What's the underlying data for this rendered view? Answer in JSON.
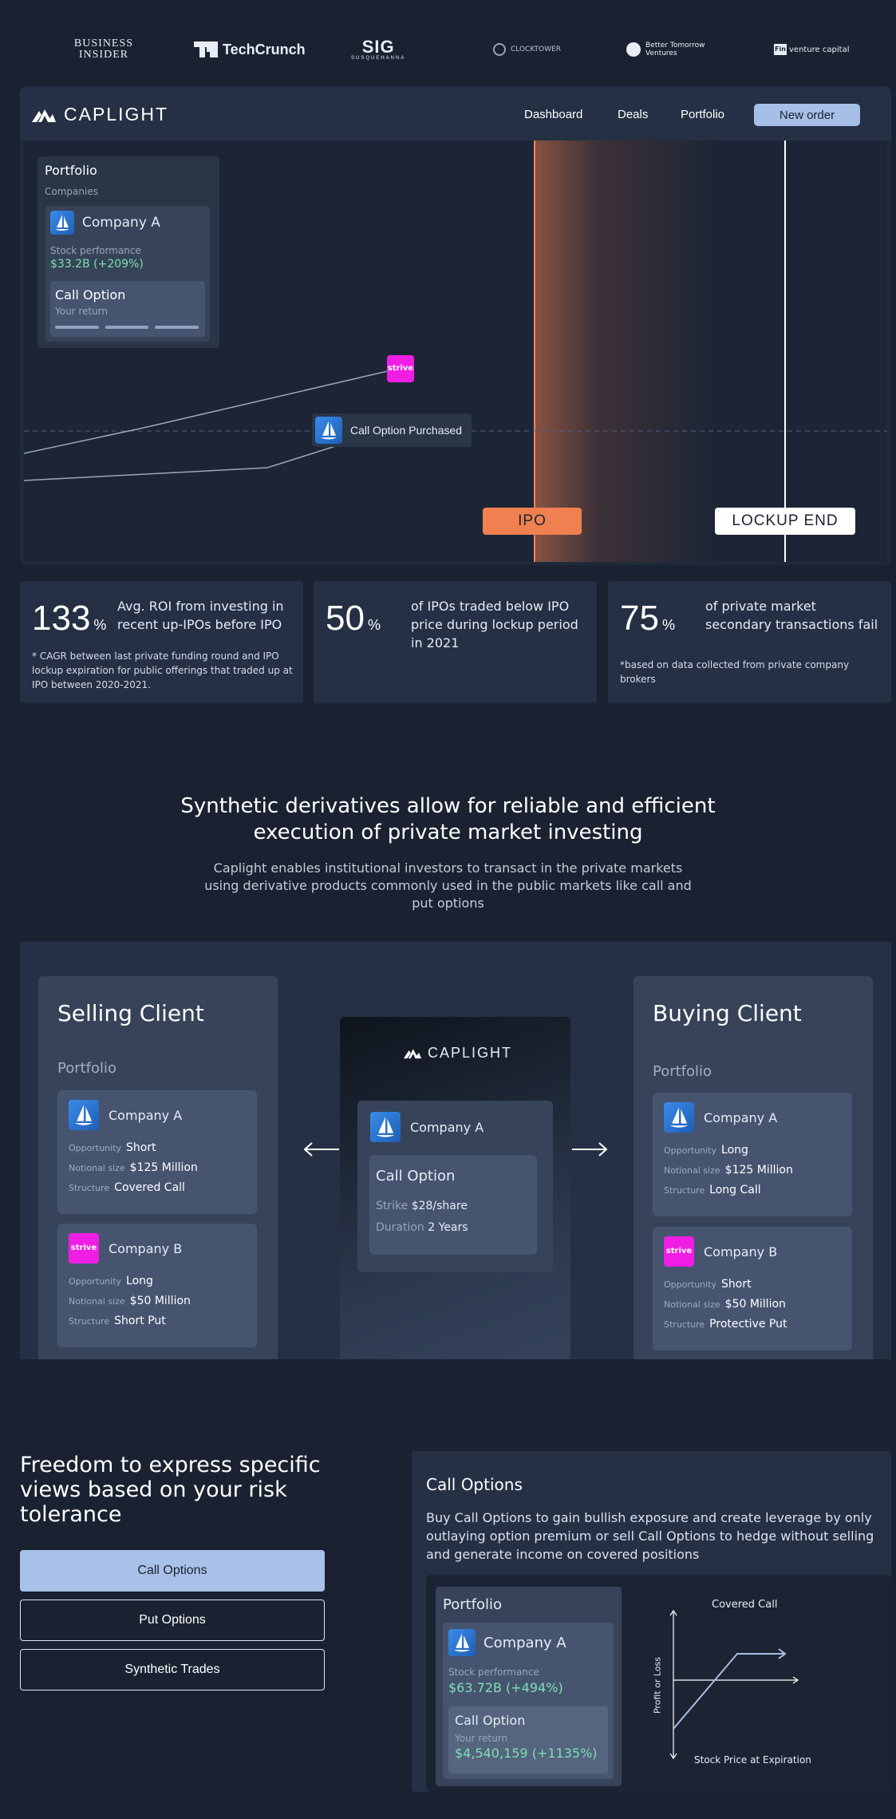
{
  "press": {
    "business_insider": [
      "BUSINESS",
      "INSIDER"
    ],
    "techcrunch": "TechCrunch",
    "sig": "SIG",
    "sig_sub": "SUSQUEHANNA",
    "clocktower": "CLOCKTOWER",
    "btv": [
      "Better Tomorrow",
      "Ventures"
    ],
    "fin": "venture capital",
    "fin_mark": "Fin"
  },
  "hero": {
    "brand": "CAPLIGHT",
    "nav": [
      "Dashboard",
      "Deals",
      "Portfolio"
    ],
    "new_order": "New order",
    "portfolio": {
      "title": "Portfolio",
      "subtitle": "Companies",
      "company": "Company A",
      "perf_label": "Stock performance",
      "perf_value": "$33.2B (+209%)",
      "call_title": "Call Option",
      "call_sub": "Your return"
    },
    "strive_label": "strive",
    "call_purchased": "Call Option Purchased",
    "ipo": "IPO",
    "lockup": "LOCKUP END",
    "colors": {
      "ipo": "#f08050",
      "accent": "#a6bfe6",
      "strive": "#f01ee4",
      "positive": "#7ee0b0"
    }
  },
  "stats": [
    {
      "num": "133",
      "pct": "%",
      "text": "Avg. ROI from investing in recent up-IPOs before IPO",
      "note": "* CAGR between last private funding round and IPO lockup expiration for public offerings that traded up at IPO between 2020-2021."
    },
    {
      "num": "50",
      "pct": "%",
      "text": "of IPOs traded below IPO price during lockup period in 2021",
      "note": ""
    },
    {
      "num": "75",
      "pct": "%",
      "text": "of private market secondary transactions fail",
      "note": "*based on data collected from private company brokers"
    }
  ],
  "section2": {
    "title": "Synthetic derivatives allow for reliable and efficient execution of private market investing",
    "desc": "Caplight enables institutional investors to transact in the private markets using derivative products commonly used in the public markets like call and put options",
    "center": {
      "brand": "CAPLIGHT",
      "company": "Company A",
      "call_title": "Call Option",
      "strike_k": "Strike",
      "strike_v": "$28/share",
      "duration_k": "Duration",
      "duration_v": "2 Years"
    },
    "selling": {
      "title": "Selling Client",
      "portfolio": "Portfolio",
      "deals": [
        {
          "company": "Company A",
          "opportunity": "Short",
          "notional": "$125 Million",
          "structure": "Covered Call"
        },
        {
          "company": "Company B",
          "opportunity": "Long",
          "notional": "$50 Million",
          "structure": "Short Put"
        }
      ]
    },
    "buying": {
      "title": "Buying Client",
      "portfolio": "Portfolio",
      "deals": [
        {
          "company": "Company A",
          "opportunity": "Long",
          "notional": "$125 Million",
          "structure": "Long Call"
        },
        {
          "company": "Company B",
          "opportunity": "Short",
          "notional": "$50 Million",
          "structure": "Protective Put"
        }
      ]
    },
    "keys": {
      "opportunity": "Opportunity",
      "notional": "Notional size",
      "structure": "Structure"
    }
  },
  "section3": {
    "title": "Freedom to express specific views based on your risk tolerance",
    "options": [
      "Call Options",
      "Put Options",
      "Synthetic Trades"
    ],
    "panel_title": "Call Options",
    "panel_desc": "Buy Call Options to gain bullish exposure and create leverage by only outlaying option premium or sell Call Options to hedge without selling and generate income on covered positions",
    "demo": {
      "title": "Portfolio",
      "company": "Company A",
      "perf_label": "Stock performance",
      "perf_value": "$63.72B (+494%)",
      "call_title": "Call Option",
      "call_sub": "Your return",
      "call_value": "$4,540,159 (+1135%)"
    },
    "payoff": {
      "title": "Covered Call",
      "xlabel": "Stock Price at Expiration",
      "ylabel": "Profit or Loss"
    }
  }
}
